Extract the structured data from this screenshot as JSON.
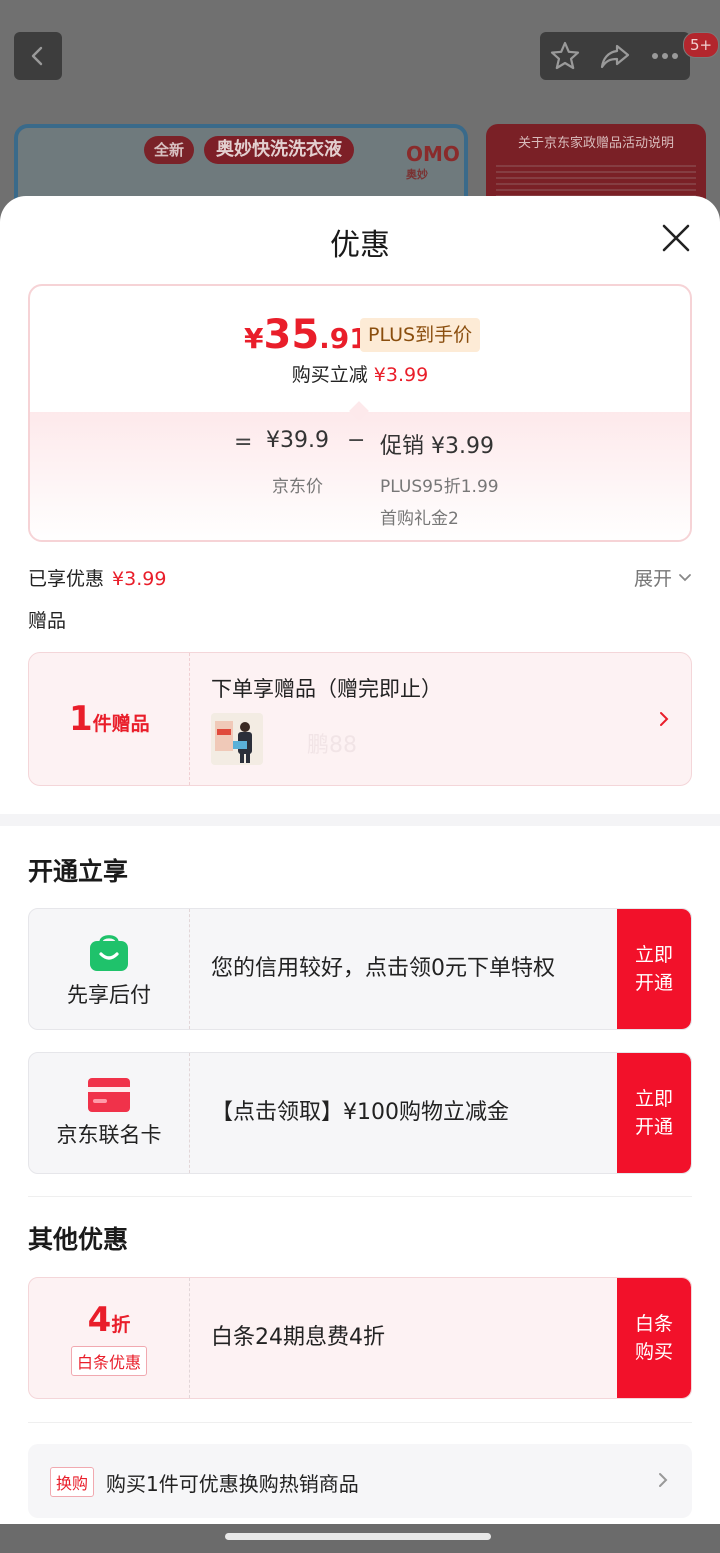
{
  "background": {
    "badge": "5+",
    "banner_left": {
      "tag": "全新",
      "title": "奥妙快洗洗衣液",
      "logo": "OMO",
      "logo_sub": "奥妙"
    },
    "banner_right": {
      "title": "关于京东家政赠品活动说明"
    }
  },
  "sheet": {
    "title": "优惠",
    "price": {
      "currency": "¥",
      "integer": "35",
      "decimal": ".91",
      "plus_tag": "PLUS到手价",
      "instant_label": "购买立减",
      "instant_amount": "¥3.99",
      "eq": "=",
      "base_price": "¥39.9",
      "minus": "−",
      "promo": "促销 ¥3.99",
      "base_label": "京东价",
      "detail_1": "PLUS95折1.99",
      "detail_2": "首购礼金2"
    },
    "enjoyed": {
      "label": "已享优惠",
      "amount": "¥3.99",
      "expand": "展开"
    },
    "gift": {
      "section_label": "赠品",
      "count": "1",
      "unit": "件赠品",
      "name": "下单享赠品（赠完即止）",
      "watermark": "鹏88"
    },
    "open_section": {
      "title": "开通立享",
      "items": [
        {
          "label": "先享后付",
          "text": "您的信用较好，点击领0元下单特权",
          "button": "立即\n开通"
        },
        {
          "label": "京东联名卡",
          "text": "【点击领取】¥100购物立减金",
          "button": "立即\n开通"
        }
      ]
    },
    "other_section": {
      "title": "其他优惠",
      "discount": {
        "number": "4",
        "unit": "折",
        "tag": "白条优惠",
        "text": "白条24期息费4折",
        "button": "白条\n购买"
      }
    },
    "swap": {
      "tag": "换购",
      "text": "购买1件可优惠换购热销商品"
    }
  },
  "colors": {
    "accent_red": "#e91e2a",
    "button_red": "#f2112a",
    "plus_gold": "#8a4e0e",
    "pay_green": "#1fc26b"
  }
}
